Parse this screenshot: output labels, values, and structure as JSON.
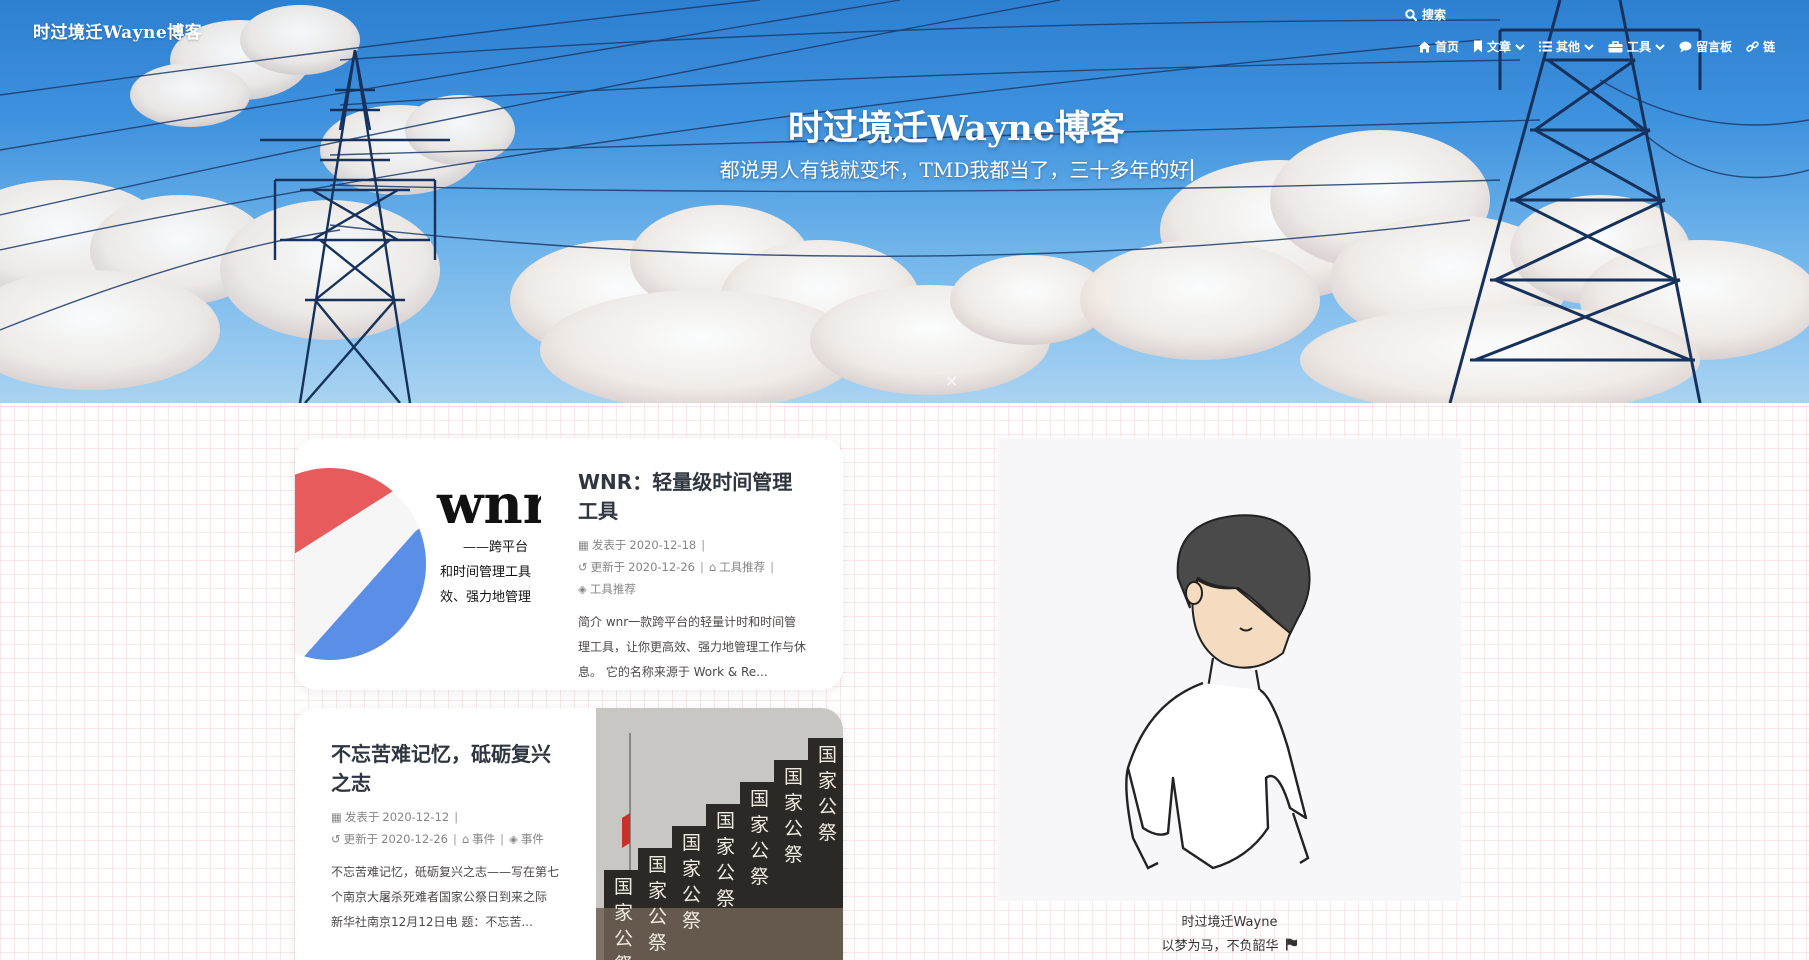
{
  "site": {
    "brand": "时过境迁Wayne博客",
    "search_label": "搜索"
  },
  "nav": {
    "items": [
      {
        "label": "首页",
        "icon": "home-icon"
      },
      {
        "label": "文章",
        "icon": "bookmark-icon",
        "dropdown": true
      },
      {
        "label": "其他",
        "icon": "list-icon",
        "dropdown": true
      },
      {
        "label": "工具",
        "icon": "toolbox-icon",
        "dropdown": true
      },
      {
        "label": "留言板",
        "icon": "comment-icon"
      },
      {
        "label": "链",
        "icon": "link-icon"
      }
    ]
  },
  "hero": {
    "title": "时过境迁Wayne博客",
    "subtitle": "都说男人有钱就变坏，TMD我都当了，三十多年的好"
  },
  "posts": [
    {
      "title": "WNR：轻量级时间管理工具",
      "published_label": "发表于",
      "published": "2020-12-18",
      "updated_label": "更新于",
      "updated": "2020-12-26",
      "category": "工具推荐",
      "tag": "工具推荐",
      "excerpt": "简介 wnr一款跨平台的轻量计时和时间管理工具，让你更高效、强力地管理工作与休息。 它的名称来源于 Work & Re...",
      "thumb": {
        "logo_text": "wnr",
        "line1": "——跨平台",
        "line2": "和时间管理工具",
        "line3": "效、强力地管理"
      }
    },
    {
      "title": "不忘苦难记忆，砥砺复兴之志",
      "published_label": "发表于",
      "published": "2020-12-12",
      "updated_label": "更新于",
      "updated": "2020-12-26",
      "category": "事件",
      "tag": "事件",
      "excerpt": "不忘苦难记忆，砥砺复兴之志——写在第七个南京大屠杀死难者国家公祭日到来之际 新华社南京12月12日电 题：不忘苦...",
      "thumb": {
        "wall_text": "国家公祭"
      }
    }
  ],
  "profile": {
    "name": "时过境迁Wayne",
    "motto": "以梦为马，不负韶华"
  },
  "colors": {
    "title_text": "#2f3640",
    "meta_text": "#858585",
    "grid_line": "#f0bebe"
  }
}
